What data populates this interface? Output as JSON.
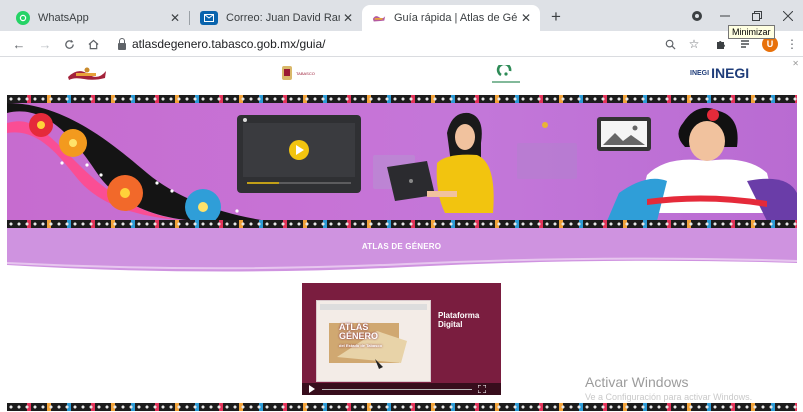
{
  "browser": {
    "tabs": [
      {
        "title": "WhatsApp",
        "icon": "whatsapp-icon",
        "color": "#25d366"
      },
      {
        "title": "Correo: Juan David Ramón - Outl",
        "icon": "outlook-icon",
        "color": "#0a64ad"
      },
      {
        "title": "Guía rápida | Atlas de Género de",
        "icon": "atlas-favicon",
        "color": "#b35aa0"
      }
    ],
    "new_tab": "+",
    "tooltip": "Minimizar",
    "url": "atlasdegenero.tabasco.gob.mx/guia/",
    "avatar_letter": "U"
  },
  "page": {
    "logo_inegi": "INEGI",
    "logo_inegi_prefix": "INEGI",
    "logo_tabasco": "TABASCO",
    "section_title": "ATLAS DE GÉNERO",
    "video": {
      "title": "Plataforma Digital",
      "screen_brand_line1": "ATLAS",
      "screen_brand_line2": "GÉNERO",
      "screen_brand_line3": "del Estado de Tabasco"
    },
    "watermark": "Activar Windows",
    "watermark_sub": "Ve a Configuración para activar Windows."
  },
  "colors": {
    "hero": "#c773d6",
    "ribbon": "#cf93e0",
    "video_bg": "#7a1d3f",
    "play": "#f2c40f"
  }
}
